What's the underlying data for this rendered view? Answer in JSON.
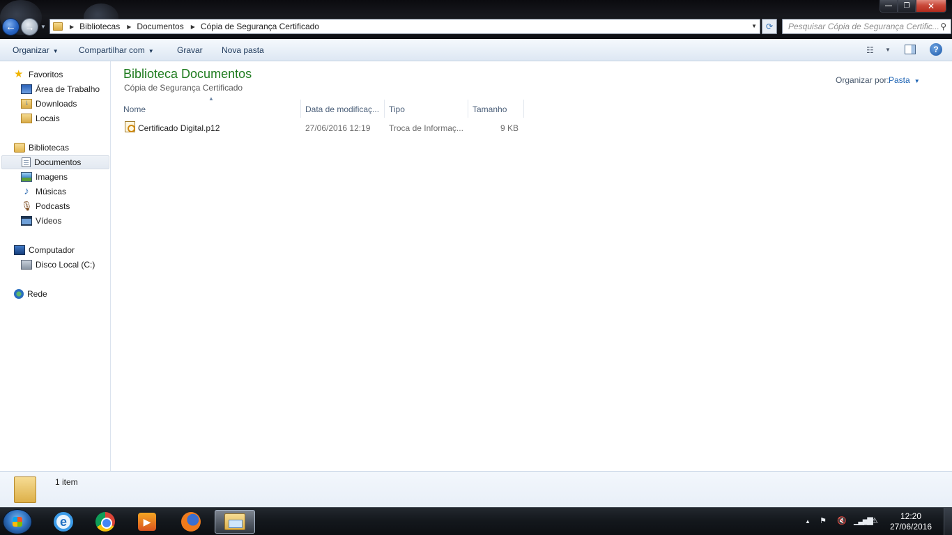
{
  "window": {
    "controls": {
      "minimize": "—",
      "maximize": "❐",
      "close": "✕"
    }
  },
  "address_bar": {
    "breadcrumbs": [
      "Bibliotecas",
      "Documentos",
      "Cópia de Segurança Certificado"
    ],
    "search_placeholder": "Pesquisar Cópia de Segurança Certific..."
  },
  "toolbar": {
    "organize": "Organizar",
    "share_with": "Compartilhar com",
    "burn": "Gravar",
    "new_folder": "Nova pasta"
  },
  "sidebar": {
    "favorites": {
      "label": "Favoritos",
      "items": [
        {
          "label": "Área de Trabalho",
          "icon": "desktop-icon"
        },
        {
          "label": "Downloads",
          "icon": "downloads-icon"
        },
        {
          "label": "Locais",
          "icon": "recent-places-icon"
        }
      ]
    },
    "libraries": {
      "label": "Bibliotecas",
      "items": [
        {
          "label": "Documentos",
          "icon": "documents-icon",
          "selected": true
        },
        {
          "label": "Imagens",
          "icon": "pictures-icon"
        },
        {
          "label": "Músicas",
          "icon": "music-icon"
        },
        {
          "label": "Podcasts",
          "icon": "podcast-icon"
        },
        {
          "label": "Vídeos",
          "icon": "videos-icon"
        }
      ]
    },
    "computer": {
      "label": "Computador",
      "items": [
        {
          "label": "Disco Local (C:)",
          "icon": "local-disk-icon"
        }
      ]
    },
    "network": {
      "label": "Rede"
    }
  },
  "main": {
    "library_title": "Biblioteca Documentos",
    "library_subtitle": "Cópia de Segurança Certificado",
    "arrange_by_label": "Organizar por:",
    "arrange_by_value": "Pasta",
    "columns": [
      "Nome",
      "Data de modificaç...",
      "Tipo",
      "Tamanho"
    ],
    "files": [
      {
        "name": "Certificado Digital.p12",
        "modified": "27/06/2016 12:19",
        "type": "Troca de Informaç...",
        "size": "9 KB"
      }
    ]
  },
  "details_pane": {
    "item_count": "1 item"
  },
  "taskbar": {
    "apps": [
      "internet-explorer",
      "google-chrome",
      "media-player",
      "firefox",
      "windows-explorer"
    ],
    "active_app": "windows-explorer",
    "clock_time": "12:20",
    "clock_date": "27/06/2016"
  }
}
